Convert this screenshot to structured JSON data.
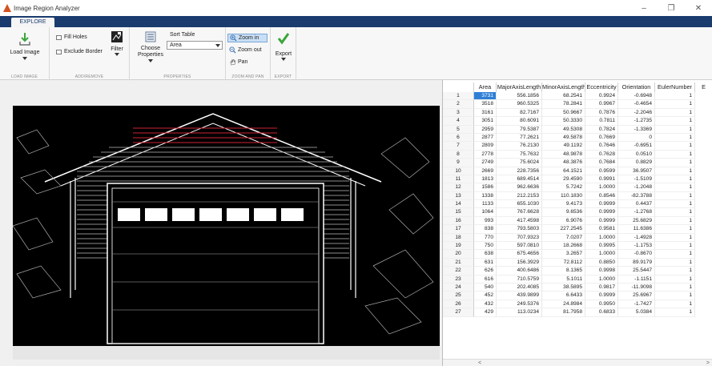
{
  "window": {
    "title": "Image Region Analyzer",
    "controls": [
      "–",
      "❐",
      "✕"
    ]
  },
  "tabs": [
    {
      "label": "EXPLORE"
    }
  ],
  "toolstrip": {
    "load_image": "Load Image",
    "fill_holes": "Fill Holes",
    "exclude_border": "Exclude Border",
    "filter": "Filter",
    "choose_properties": "Choose Properties",
    "sort_table_label": "Sort Table",
    "sort_table_value": "Area",
    "zoom_in": "Zoom in",
    "zoom_out": "Zoom out",
    "pan": "Pan",
    "export": "Export",
    "sections": {
      "load_image": "LOAD IMAGE",
      "add_remove": "ADD/REMOVE",
      "properties": "PROPERTIES",
      "zoom_pan": "ZOOM AND PAN",
      "export": "EXPORT"
    }
  },
  "colors": {
    "title_accent": "#1a3b6e",
    "selection": "#2f7fd6",
    "export_check": "#3aa63a"
  },
  "table": {
    "columns": [
      "",
      "Area",
      "MajorAxisLength",
      "MinorAxisLength",
      "Eccentricity",
      "Orientation",
      "EulerNumber",
      "E"
    ],
    "rows": [
      [
        "1",
        "3731",
        "556.1856",
        "68.2541",
        "0.9924",
        "-0.6948",
        "1"
      ],
      [
        "2",
        "3518",
        "960.5325",
        "78.2841",
        "0.9967",
        "-0.4654",
        "1"
      ],
      [
        "3",
        "3161",
        "82.7167",
        "50.9667",
        "0.7876",
        "-2.2046",
        "1"
      ],
      [
        "4",
        "3051",
        "80.6091",
        "50.3330",
        "0.7811",
        "-1.2735",
        "1"
      ],
      [
        "5",
        "2959",
        "79.5387",
        "49.5308",
        "0.7824",
        "-1.3369",
        "1"
      ],
      [
        "6",
        "2877",
        "77.2621",
        "49.5878",
        "0.7669",
        "0",
        "1"
      ],
      [
        "7",
        "2809",
        "76.2130",
        "49.1192",
        "0.7646",
        "-0.6951",
        "1"
      ],
      [
        "8",
        "2778",
        "75.7632",
        "48.9878",
        "0.7628",
        "0.0510",
        "1"
      ],
      [
        "9",
        "2749",
        "75.6024",
        "48.3876",
        "0.7684",
        "0.8829",
        "1"
      ],
      [
        "10",
        "2669",
        "228.7356",
        "64.1521",
        "0.9599",
        "36.9507",
        "1"
      ],
      [
        "11",
        "1813",
        "689.4514",
        "29.4590",
        "0.9991",
        "-1.5109",
        "1"
      ],
      [
        "12",
        "1586",
        "962.6636",
        "5.7242",
        "1.0000",
        "-1.2048",
        "1"
      ],
      [
        "13",
        "1338",
        "212.2153",
        "110.1830",
        "0.8546",
        "-82.3788",
        "1"
      ],
      [
        "14",
        "1133",
        "655.1030",
        "9.4173",
        "0.9999",
        "0.4437",
        "1"
      ],
      [
        "15",
        "1064",
        "767.6628",
        "9.6536",
        "0.9999",
        "-1.2768",
        "1"
      ],
      [
        "16",
        "993",
        "417.4598",
        "6.9076",
        "0.9999",
        "25.6829",
        "1"
      ],
      [
        "17",
        "838",
        "793.5803",
        "227.2545",
        "0.9581",
        "11.6386",
        "1"
      ],
      [
        "18",
        "770",
        "707.9323",
        "7.0207",
        "1.0000",
        "-1.4928",
        "1"
      ],
      [
        "19",
        "750",
        "597.0810",
        "18.2668",
        "0.9995",
        "-1.1753",
        "1"
      ],
      [
        "20",
        "638",
        "675.4656",
        "3.2657",
        "1.0000",
        "-0.8670",
        "1"
      ],
      [
        "21",
        "631",
        "156.3929",
        "72.8112",
        "0.8850",
        "89.9179",
        "1"
      ],
      [
        "22",
        "626",
        "400.6486",
        "8.1365",
        "0.9998",
        "25.5447",
        "1"
      ],
      [
        "23",
        "616",
        "710.5759",
        "5.1011",
        "1.0000",
        "-1.1151",
        "1"
      ],
      [
        "24",
        "540",
        "202.4085",
        "38.5895",
        "0.9817",
        "-11.9098",
        "1"
      ],
      [
        "25",
        "452",
        "439.9899",
        "6.6433",
        "0.9999",
        "25.6967",
        "1"
      ],
      [
        "26",
        "432",
        "249.5376",
        "24.8984",
        "0.9950",
        "-1.7427",
        "1"
      ],
      [
        "27",
        "429",
        "113.0234",
        "81.7958",
        "0.6833",
        "5.0384",
        "1"
      ]
    ],
    "selected_row": 0
  }
}
